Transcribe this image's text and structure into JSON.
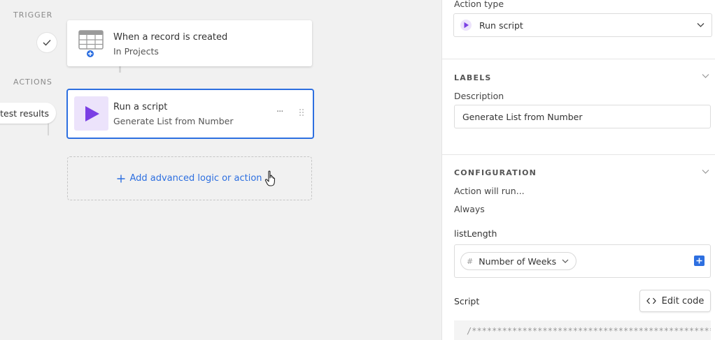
{
  "canvas": {
    "trigger_label": "TRIGGER",
    "actions_label": "ACTIONS",
    "trigger": {
      "title": "When a record is created",
      "subtitle": "In Projects"
    },
    "action": {
      "title": "Run a script",
      "subtitle": "Generate List from Number",
      "more": "···"
    },
    "test_results_label": "w test results",
    "add_action_label": "Add advanced logic or action"
  },
  "panel": {
    "action_type_label": "Action type",
    "action_type_value": "Run script",
    "labels_heading": "LABELS",
    "description_label": "Description",
    "description_value": "Generate List from Number",
    "configuration_heading": "CONFIGURATION",
    "action_will_run_label": "Action will run...",
    "action_will_run_value": "Always",
    "input_name": "listLength",
    "input_token_value": "Number of Weeks",
    "input_token_icon": "#",
    "script_label": "Script",
    "edit_code_label": "Edit code",
    "code_preview": "/*****************************************************"
  },
  "colors": {
    "accent": "#2d6fe0",
    "script_purple": "#7a3fe4",
    "script_bg": "#ece3fb"
  },
  "icons": [
    "check-icon",
    "table-icon",
    "add-badge-icon",
    "play-icon",
    "more-icon",
    "drag-handle-icon",
    "plus-icon",
    "cursor-hand-icon",
    "chevron-down-icon",
    "code-icon"
  ]
}
